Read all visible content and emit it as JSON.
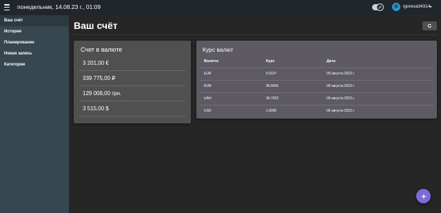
{
  "header": {
    "datetime": "понедельник, 14.08.23 г., 01:09",
    "username": "igorexa34314"
  },
  "sidebar": {
    "items": [
      {
        "label": "Ваш счёт",
        "active": true
      },
      {
        "label": "История",
        "active": false
      },
      {
        "label": "Планирование",
        "active": false
      },
      {
        "label": "Новая запись",
        "active": false
      },
      {
        "label": "Категории",
        "active": false
      }
    ]
  },
  "main": {
    "title": "Ваш счёт"
  },
  "bill": {
    "title": "Счет в валюте",
    "values": [
      "3 201,00 €",
      "339 775,00 ₽",
      "129 008,00 грн.",
      "3 515,00 $"
    ]
  },
  "rates": {
    "title": "Курс валют",
    "headers": [
      "Валюта",
      "Курс",
      "Дата"
    ],
    "rows": [
      {
        "currency": "EUR",
        "rate": "0.9107",
        "date": "09 августа 2023 г."
      },
      {
        "currency": "RUB",
        "rate": "96.6643",
        "date": "09 августа 2023 г."
      },
      {
        "currency": "UAH",
        "rate": "36.7022",
        "date": "09 августа 2023 г."
      },
      {
        "currency": "USD",
        "rate": "1.0000",
        "date": "09 августа 2023 г."
      }
    ]
  },
  "icons": {
    "menu": "menu-icon",
    "theme_toggle": "dark-mode-toggle",
    "refresh": "refresh-icon",
    "add": "plus-icon"
  },
  "colors": {
    "accent": "#7c6bd6",
    "sidebar": "#37474f",
    "topbar": "#21262c"
  }
}
